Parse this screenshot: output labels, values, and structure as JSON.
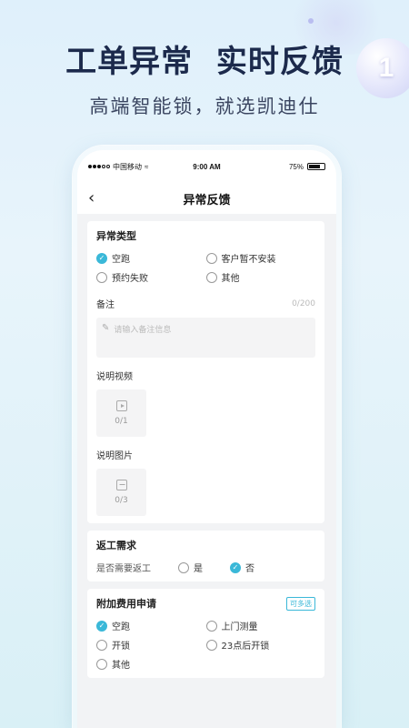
{
  "headline": "工单异常  实时反馈",
  "subline": "高端智能锁，就选凯迪仕",
  "badge_number": "1",
  "status_bar": {
    "carrier": "中国移动",
    "time": "9:00 AM",
    "battery": "75%",
    "battery_level": 0.75
  },
  "nav": {
    "back_icon": "chevron-left-icon",
    "title": "异常反馈"
  },
  "exception_card": {
    "title": "异常类型",
    "options": [
      {
        "label": "空跑",
        "checked": true
      },
      {
        "label": "客户暂不安装",
        "checked": false
      },
      {
        "label": "预约失败",
        "checked": false
      },
      {
        "label": "其他",
        "checked": false
      }
    ],
    "remark_label": "备注",
    "remark_counter": "0/200",
    "remark_placeholder": "请输入备注信息",
    "video_label": "说明视频",
    "video_count": "0/1",
    "image_label": "说明图片",
    "image_count": "0/3"
  },
  "rework_card": {
    "title": "返工需求",
    "question": "是否需要返工",
    "options": [
      {
        "label": "是",
        "checked": false
      },
      {
        "label": "否",
        "checked": true
      }
    ]
  },
  "fee_card": {
    "title": "附加费用申请",
    "badge": "可多选",
    "options": [
      {
        "label": "空跑",
        "checked": true
      },
      {
        "label": "上门测量",
        "checked": false
      },
      {
        "label": "开锁",
        "checked": false
      },
      {
        "label": "23点后开锁",
        "checked": false
      },
      {
        "label": "其他",
        "checked": false
      }
    ]
  },
  "colors": {
    "accent": "#3ab8d8",
    "headline": "#1c2a4c"
  }
}
